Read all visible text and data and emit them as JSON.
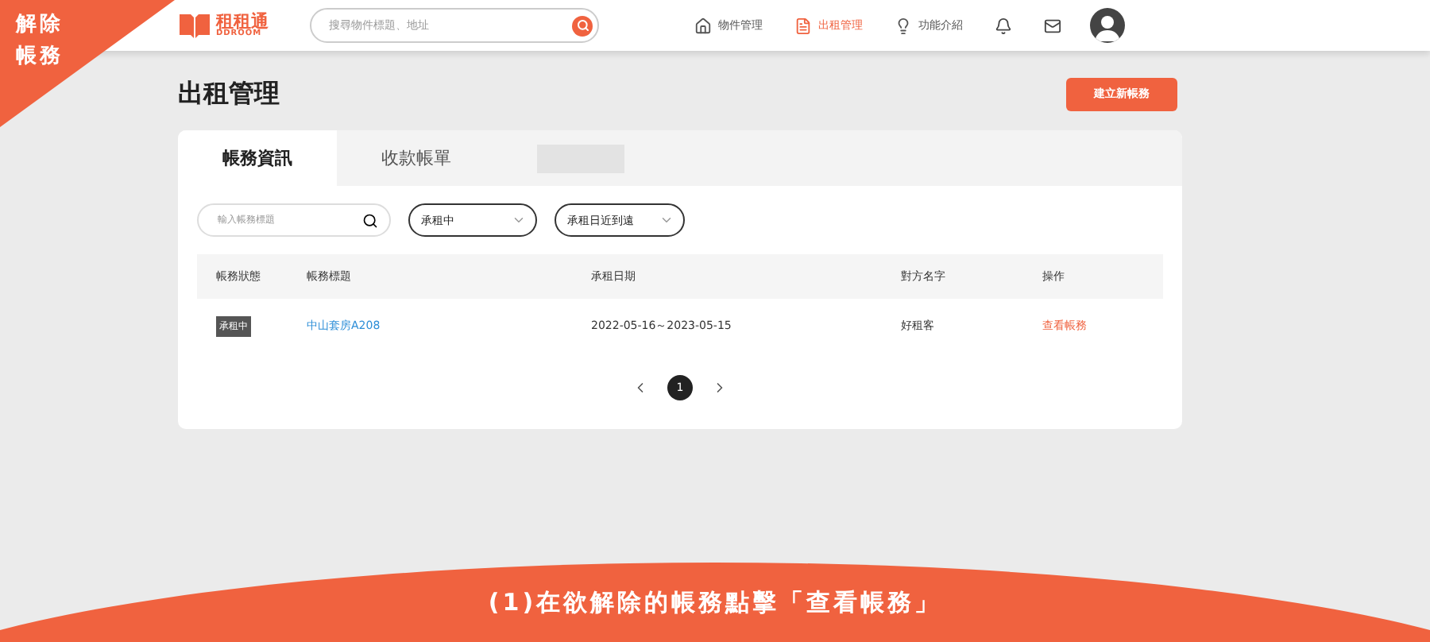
{
  "corner_label": {
    "lines": [
      "解除",
      "帳務"
    ]
  },
  "header": {
    "logo": {
      "name": "租租通",
      "sub": "DDROOM"
    },
    "search": {
      "placeholder": "搜尋物件標題、地址"
    },
    "nav": [
      {
        "label": "物件管理",
        "kind": "house",
        "selected": false
      },
      {
        "label": "出租管理",
        "kind": "doc",
        "selected": true
      },
      {
        "label": "功能介紹",
        "kind": "bulb",
        "selected": false
      }
    ]
  },
  "page_title": "出租管理",
  "create_button": "建立新帳務",
  "tabs": [
    {
      "label": "帳務資訊",
      "selected": true
    },
    {
      "label": "收款帳單",
      "selected": false
    }
  ],
  "filters": {
    "search": {
      "placeholder": "輸入帳務標題"
    },
    "selects": [
      {
        "value": "承租中"
      },
      {
        "value": "承租日近到遠"
      }
    ]
  },
  "table": {
    "columns": [
      "帳務狀態",
      "帳務標題",
      "承租日期",
      "對方名字",
      "操作"
    ],
    "rows": [
      {
        "status": "承租中",
        "title": "中山套房A208",
        "date": "2022-05-16～2023-05-15",
        "name": "好租客",
        "action": "查看帳務"
      }
    ]
  },
  "pagination": {
    "pages": [
      {
        "label": "1",
        "selected": true
      }
    ]
  },
  "caption": "(1)在欲解除的帳務點擊「查看帳務」"
}
